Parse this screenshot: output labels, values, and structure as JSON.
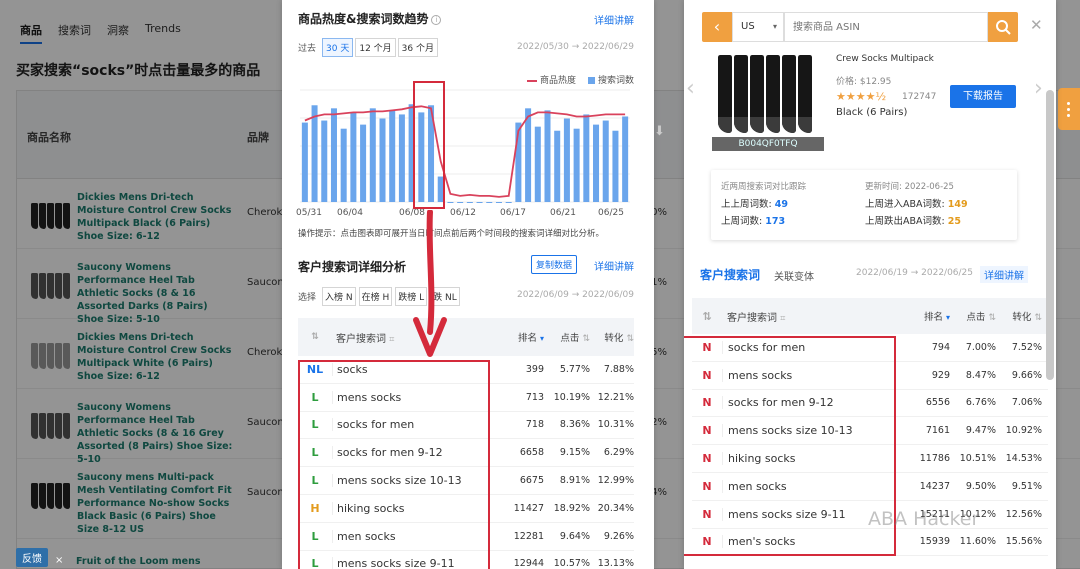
{
  "background": {
    "tabs": [
      "商品",
      "搜索词",
      "洞察",
      "Trends"
    ],
    "title": "买家搜索“socks”时点击量最多的商品",
    "columns": [
      "商品名称",
      "品牌"
    ],
    "rows": [
      {
        "name": "Dickies Mens Dri-tech Moisture Control Crew Socks Multipack Black (6 Pairs) Shoe Size: 6-12",
        "brand": "Cheroke",
        "pct": "0%"
      },
      {
        "name": "Saucony Womens Performance Heel Tab Athletic Socks (8 & 16 Assorted Darks (8 Pairs) Shoe Size: 5-10",
        "brand": "Saucony",
        "pct": "1%"
      },
      {
        "name": "Dickies Mens Dri-tech Moisture Control Crew Socks Multipack White (6 Pairs) Shoe Size: 6-12",
        "brand": "Cheroke",
        "pct": "5%"
      },
      {
        "name": "Saucony Womens Performance Heel Tab Athletic Socks (8 & 16 Grey Assorted (8 Pairs) Shoe Size: 5-10",
        "brand": "Saucony",
        "pct": "2%"
      },
      {
        "name": "Saucony mens Multi-pack Mesh Ventilating Comfort Fit Performance No-show Socks Black Basic (6 Pairs) Shoe Size 8-12 US",
        "brand": "Saucony",
        "pct": "4%"
      }
    ],
    "last_row": "Fruit of the Loom mens",
    "feedback": "反馈",
    "feedback_close": "×"
  },
  "mid": {
    "trend_title": "商品热度&搜索词数趋势",
    "detail_link": "详细讲解",
    "range_label": "过去",
    "ranges": [
      "30 天",
      "12 个月",
      "36 个月"
    ],
    "date_range": "2022/05/30 → 2022/06/29",
    "legend": {
      "heat": "商品热度",
      "search": "搜索词数"
    },
    "x_ticks": [
      "05/31",
      "06/04",
      "06/08",
      "06/12",
      "06/17",
      "06/21",
      "06/25"
    ],
    "tip": "操作提示：点击图表即可展开当日时间点前后两个时间段的搜索词详细对比分析。",
    "detail_title": "客户搜索词详细分析",
    "copy_btn": "复制数据",
    "detail_link2": "详细讲解",
    "filter_label": "选择",
    "filters": [
      "入榜 N",
      "在榜 H",
      "跌榜 L",
      "跌 NL"
    ],
    "date_range2": "2022/06/09 → 2022/06/09",
    "table_head": {
      "kw": "客户搜索词",
      "rank": "排名",
      "click": "点击",
      "conv": "转化"
    },
    "rows": [
      {
        "tag": "NL",
        "kw": "socks",
        "rank": "399",
        "click": "5.77%",
        "conv": "7.88%"
      },
      {
        "tag": "L",
        "kw": "mens socks",
        "rank": "713",
        "click": "10.19%",
        "conv": "12.21%"
      },
      {
        "tag": "L",
        "kw": "socks for men",
        "rank": "718",
        "click": "8.36%",
        "conv": "10.31%"
      },
      {
        "tag": "L",
        "kw": "socks for men 9-12",
        "rank": "6658",
        "click": "9.15%",
        "conv": "6.29%"
      },
      {
        "tag": "L",
        "kw": "mens socks size 10-13",
        "rank": "6675",
        "click": "8.91%",
        "conv": "12.99%"
      },
      {
        "tag": "H",
        "kw": "hiking socks",
        "rank": "11427",
        "click": "18.92%",
        "conv": "20.34%"
      },
      {
        "tag": "L",
        "kw": "men socks",
        "rank": "12281",
        "click": "9.64%",
        "conv": "9.26%"
      },
      {
        "tag": "L",
        "kw": "mens socks size 9-11",
        "rank": "12944",
        "click": "10.57%",
        "conv": "13.13%"
      }
    ]
  },
  "chart_data": {
    "type": "bar",
    "title": "商品热度&搜索词数趋势",
    "x_ticks": [
      "05/31",
      "06/04",
      "06/08",
      "06/12",
      "06/17",
      "06/21",
      "06/25"
    ],
    "series": [
      {
        "name": "搜索词数",
        "kind": "bar",
        "values": [
          78,
          95,
          80,
          92,
          72,
          88,
          76,
          92,
          82,
          90,
          86,
          96,
          88,
          95,
          25,
          0,
          0,
          0,
          0,
          0,
          0,
          0,
          78,
          92,
          74,
          90,
          70,
          82,
          72,
          86,
          76,
          80,
          70,
          84
        ]
      },
      {
        "name": "商品热度",
        "kind": "line",
        "values": [
          80,
          84,
          86,
          86,
          87,
          88,
          88,
          89,
          89,
          90,
          91,
          93,
          94,
          92,
          40,
          8,
          6,
          7,
          6,
          6,
          5,
          6,
          70,
          84,
          88,
          88,
          87,
          86,
          84,
          84,
          85,
          86,
          86,
          86
        ]
      }
    ],
    "ylim": [
      0,
      110
    ]
  },
  "right": {
    "country": "US",
    "search_placeholder": "搜索商品 ASIN",
    "product_title": "Crew Socks Multipack",
    "price": "价格: $12.95",
    "stars": "★★★★½",
    "reviews": "172747",
    "variant": "Black (6 Pairs)",
    "asin": "B004QF0TFQ",
    "download": "下载报告",
    "stats": {
      "left_title": "近两周搜索词对比跟踪",
      "last_week_label": "上上周词数:",
      "last_week_val": "49",
      "this_week_label": "上周词数:",
      "this_week_val": "173",
      "update_label": "更新时间: 2022-06-25",
      "enter_label": "上周进入ABA词数:",
      "enter_val": "149",
      "drop_label": "上周跌出ABA词数:",
      "drop_val": "25"
    },
    "tab_active": "客户搜索词",
    "tab_other": "关联变体",
    "date_range": "2022/06/19 → 2022/06/25",
    "detail_link": "详细讲解",
    "table_head": {
      "kw": "客户搜索词",
      "rank": "排名",
      "click": "点击",
      "conv": "转化"
    },
    "rows": [
      {
        "tag": "N",
        "kw": "socks for men",
        "rank": "794",
        "click": "7.00%",
        "conv": "7.52%"
      },
      {
        "tag": "N",
        "kw": "mens socks",
        "rank": "929",
        "click": "8.47%",
        "conv": "9.66%"
      },
      {
        "tag": "N",
        "kw": "socks for men 9-12",
        "rank": "6556",
        "click": "6.76%",
        "conv": "7.06%"
      },
      {
        "tag": "N",
        "kw": "mens socks size 10-13",
        "rank": "7161",
        "click": "9.47%",
        "conv": "10.92%"
      },
      {
        "tag": "N",
        "kw": "hiking socks",
        "rank": "11786",
        "click": "10.51%",
        "conv": "14.53%"
      },
      {
        "tag": "N",
        "kw": "men socks",
        "rank": "14237",
        "click": "9.50%",
        "conv": "9.51%"
      },
      {
        "tag": "N",
        "kw": "mens socks size 9-11",
        "rank": "15211",
        "click": "10.12%",
        "conv": "12.56%"
      },
      {
        "tag": "N",
        "kw": "men's socks",
        "rank": "15939",
        "click": "11.60%",
        "conv": "15.56%"
      }
    ],
    "watermark": "ABA Hacker"
  },
  "colors": {
    "accent": "#1a73e8",
    "orange": "#f0a040",
    "red": "#d42a3b",
    "bar": "#6aa5ec",
    "line": "#d9425c"
  }
}
